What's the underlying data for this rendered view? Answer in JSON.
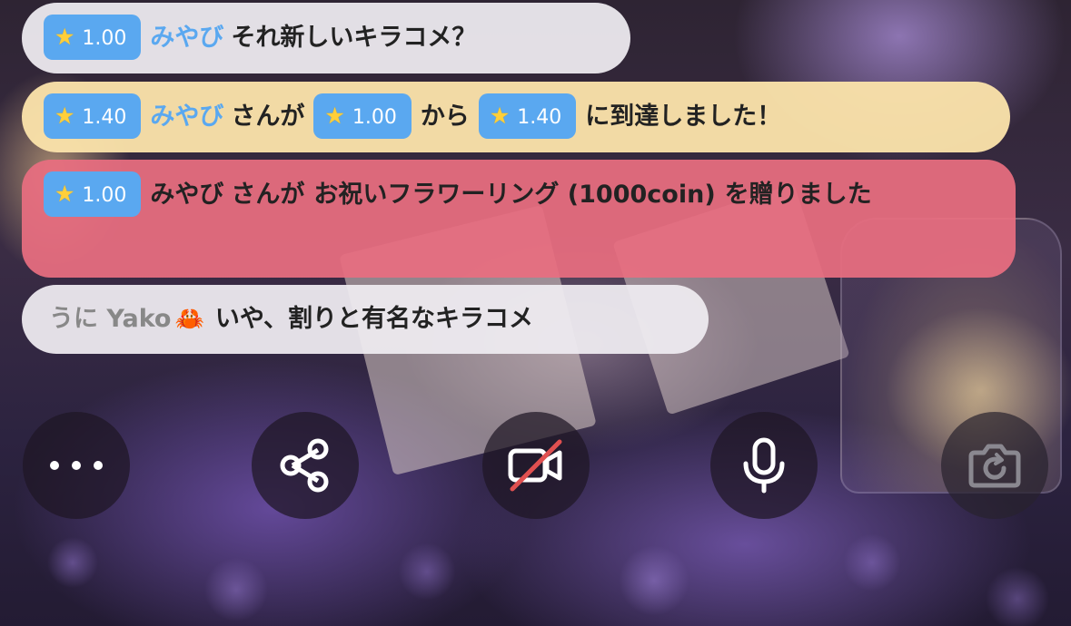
{
  "chat": {
    "messages": [
      {
        "badge": "1.00",
        "user": "みやび",
        "text": "それ新しいキラコメ？"
      },
      {
        "badge": "1.40",
        "user": "みやび",
        "part1": "さんが",
        "from_badge": "1.00",
        "part2": "から",
        "to_badge": "1.40",
        "part3": "に到達しました！"
      },
      {
        "badge": "1.00",
        "user": "みやび",
        "part1": "さんが",
        "gift": "お祝いフラワーリング (1000coin)",
        "part2": "を贈りました"
      },
      {
        "user": "うに Yako",
        "emoji": "🦀",
        "text": "いや、割りと有名なキラコメ"
      }
    ]
  },
  "colors": {
    "badge_blue": "#5aa8f0",
    "level_up_bg": "#fae2aa",
    "gift_bg": "#e86e80",
    "comment_bg": "#eeebf0"
  },
  "toolbar": {
    "buttons": [
      {
        "icon": "more-icon"
      },
      {
        "icon": "share-icon"
      },
      {
        "icon": "video-off-icon"
      },
      {
        "icon": "microphone-icon"
      },
      {
        "icon": "camera-flip-icon"
      }
    ]
  }
}
